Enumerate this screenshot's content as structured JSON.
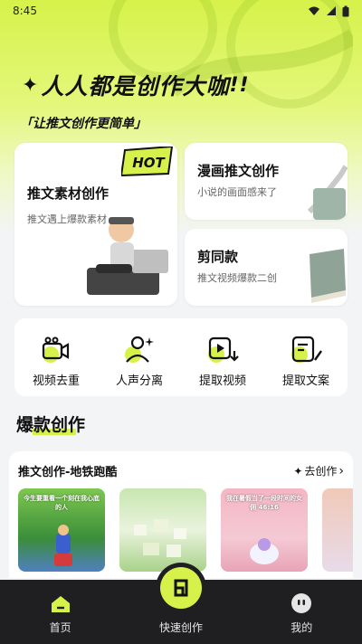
{
  "status_bar": {
    "time": "8:45"
  },
  "hero": {
    "slogan": "人人都是创作大咖",
    "sub_slogan": "「让推文创作更简单」"
  },
  "cards": {
    "material": {
      "title": "推文素材创作",
      "subtitle": "推文遇上爆款素材",
      "badge": "HOT"
    },
    "comic": {
      "title": "漫画推文创作",
      "subtitle": "小说的画面感来了"
    },
    "clip": {
      "title": "剪同款",
      "subtitle": "推文视频爆款二创"
    }
  },
  "tools": [
    {
      "label": "视频去重",
      "icon": "video-camera-icon"
    },
    {
      "label": "人声分离",
      "icon": "person-sparkle-icon"
    },
    {
      "label": "提取视频",
      "icon": "video-extract-icon"
    },
    {
      "label": "提取文案",
      "icon": "document-edit-icon"
    }
  ],
  "section": {
    "title": "爆款创作"
  },
  "feed": {
    "title": "推文创作-地铁跑酷",
    "more_label": "去创作",
    "thumbs": [
      {
        "caption": "今生要重看一个刻在我心底的人",
        "icon": "game-scene-thumbnail"
      },
      {
        "caption": "",
        "icon": "food-thumbnail"
      },
      {
        "caption": "我在暑假当了一段时间的女佣 46:16",
        "icon": "pink-game-thumbnail"
      },
      {
        "caption": "",
        "icon": "partial-thumbnail"
      }
    ]
  },
  "nav": {
    "home": "首页",
    "create": "快速创作",
    "mine": "我的"
  },
  "colors": {
    "accent": "#d6f24a",
    "nav_bg": "#1f1f22"
  }
}
